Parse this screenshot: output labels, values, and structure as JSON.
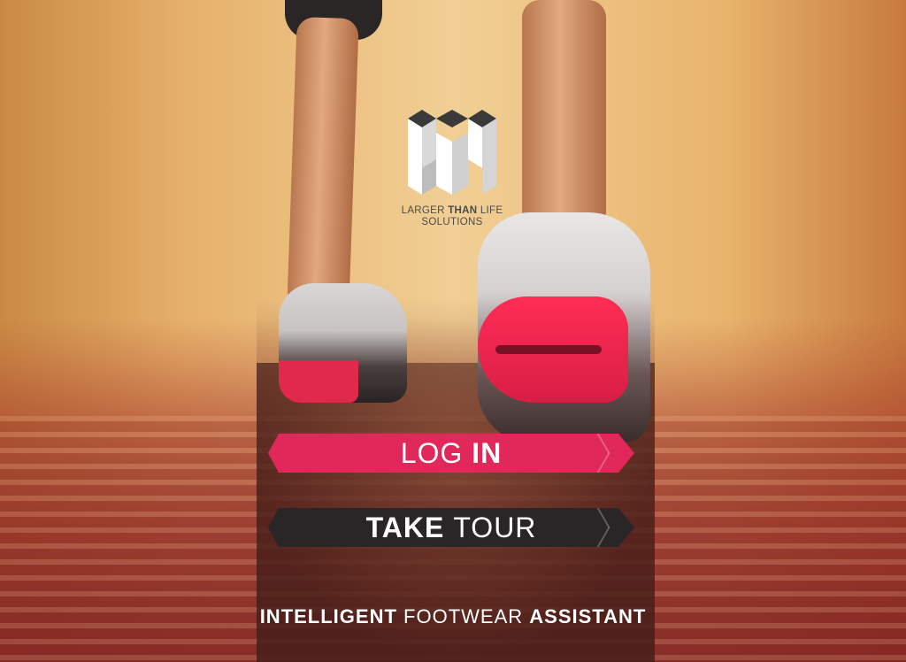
{
  "brand": {
    "line1_a": "LARGER",
    "line1_b": "THAN",
    "line1_c": "LIFE",
    "line2": "SOLUTIONS"
  },
  "buttons": {
    "login_a": "LOG",
    "login_b": "IN",
    "tour_a": "TAKE",
    "tour_b": "TOUR"
  },
  "tagline": {
    "part1": "INTELLIGENT",
    "part2": "FOOTWEAR",
    "part3": "ASSISTANT"
  },
  "colors": {
    "login": "#e0285a",
    "tour": "#2a2627"
  }
}
